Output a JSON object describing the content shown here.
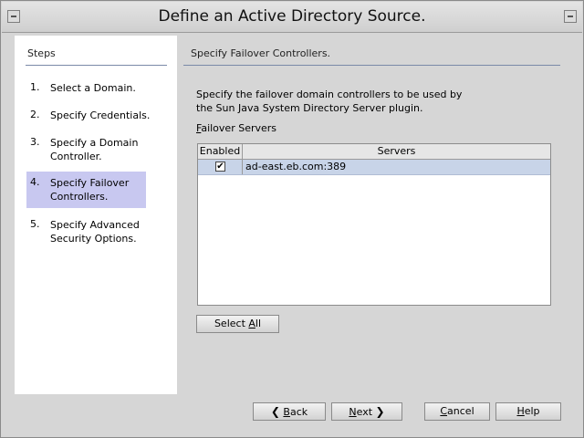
{
  "window": {
    "title": "Define an Active Directory Source."
  },
  "steps": {
    "header": "Steps",
    "items": [
      {
        "num": "1.",
        "label": "Select a Domain."
      },
      {
        "num": "2.",
        "label": "Specify Credentials."
      },
      {
        "num": "3.",
        "label": "Specify a Domain Controller."
      },
      {
        "num": "4.",
        "label": "Specify Failover Controllers."
      },
      {
        "num": "5.",
        "label": "Specify Advanced Security Options."
      }
    ],
    "active_index": 3
  },
  "content": {
    "title": "Specify Failover Controllers.",
    "description": "Specify the failover domain controllers to be used by the Sun Java System Directory Server plugin.",
    "failover_label": "Failover Servers",
    "table": {
      "columns": [
        "Enabled",
        "Servers"
      ],
      "rows": [
        {
          "enabled": true,
          "server": "ad-east.eb.com:389"
        }
      ]
    },
    "select_all": "Select All"
  },
  "buttons": {
    "back": "Back",
    "next": "Next",
    "cancel": "Cancel",
    "help": "Help"
  },
  "colors": {
    "active_step": "#c8c8f0",
    "selected_row": "#c8d4e8",
    "rule": "#7a8aa8"
  }
}
